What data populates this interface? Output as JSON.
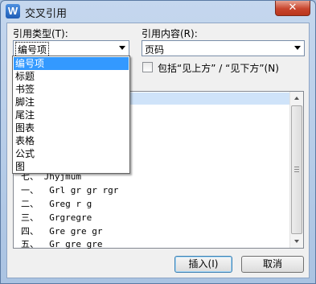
{
  "window": {
    "title": "交叉引用",
    "app_icon": "W",
    "close_label": "✕"
  },
  "ref_type": {
    "label": "引用类型(T):",
    "value": "编号项"
  },
  "ref_content": {
    "label": "引用内容(R):",
    "value": "页码"
  },
  "include_checkbox": {
    "label": "包括“见上方” / “见下方”(N)",
    "checked": false
  },
  "dropdown": {
    "items": [
      "编号项",
      "标题",
      "书签",
      "脚注",
      "尾注",
      "图表",
      "表格",
      "公式",
      "图"
    ],
    "selected_index": 0
  },
  "list": {
    "items": [
      "七、 Jhyjmum",
      "一、  Grl gr gr rgr",
      "二、  Greg r g",
      "三、  Grgregre",
      "四、  Gre gre gr",
      "五、  Gr gre gre"
    ]
  },
  "buttons": {
    "insert": "插入(I)",
    "cancel": "取消"
  }
}
